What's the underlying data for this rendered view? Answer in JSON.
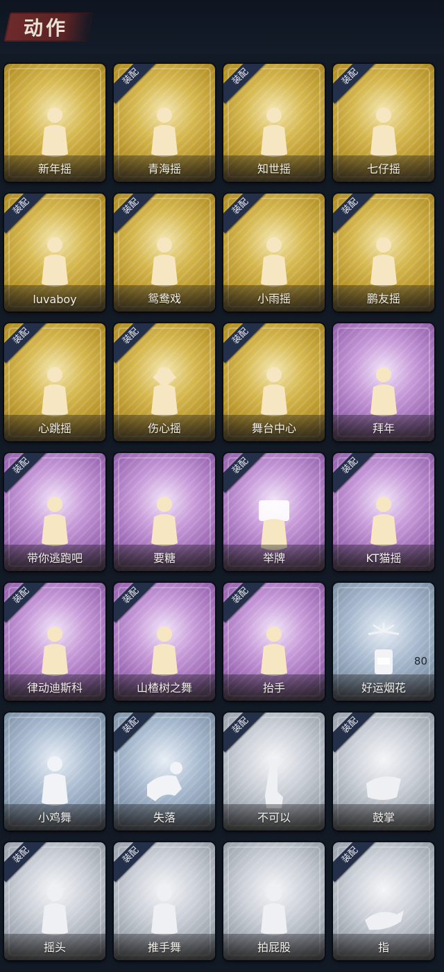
{
  "page": {
    "title": "动作",
    "colors": {
      "gold": "#d6b84f",
      "purple": "#b786cc",
      "blue": "#8ea2b7",
      "silver": "#aeb4bd"
    }
  },
  "badge_text": "装配",
  "cards": [
    {
      "label": "新年摇",
      "tier": "gold",
      "equipped": false,
      "icon": "dancer-icon"
    },
    {
      "label": "青海摇",
      "tier": "gold",
      "equipped": true,
      "icon": "dancer-icon"
    },
    {
      "label": "知世摇",
      "tier": "gold",
      "equipped": true,
      "icon": "dancer-icon"
    },
    {
      "label": "七仔摇",
      "tier": "gold",
      "equipped": true,
      "icon": "dancer-icon"
    },
    {
      "label": "luvaboy",
      "tier": "gold",
      "equipped": true,
      "icon": "dancer-icon"
    },
    {
      "label": "鸳鸯戏",
      "tier": "gold",
      "equipped": true,
      "icon": "dancer-icon"
    },
    {
      "label": "小雨摇",
      "tier": "gold",
      "equipped": true,
      "icon": "dancer-icon"
    },
    {
      "label": "鹏友摇",
      "tier": "gold",
      "equipped": true,
      "icon": "dancer-icon"
    },
    {
      "label": "心跳摇",
      "tier": "gold",
      "equipped": true,
      "icon": "dancer-icon"
    },
    {
      "label": "伤心摇",
      "tier": "gold",
      "equipped": true,
      "icon": "heart-hands-icon"
    },
    {
      "label": "舞台中心",
      "tier": "gold",
      "equipped": true,
      "icon": "dancer-icon"
    },
    {
      "label": "拜年",
      "tier": "purple",
      "equipped": false,
      "icon": "bow-icon"
    },
    {
      "label": "带你逃跑吧",
      "tier": "purple",
      "equipped": true,
      "icon": "dancer-icon"
    },
    {
      "label": "要糖",
      "tier": "purple",
      "equipped": false,
      "icon": "beg-icon"
    },
    {
      "label": "举牌",
      "tier": "purple",
      "equipped": true,
      "icon": "sign-icon"
    },
    {
      "label": "KT猫摇",
      "tier": "purple",
      "equipped": true,
      "icon": "dancer-icon"
    },
    {
      "label": "律动迪斯科",
      "tier": "purple",
      "equipped": true,
      "icon": "dancer-icon"
    },
    {
      "label": "山楂树之舞",
      "tier": "purple",
      "equipped": true,
      "icon": "dancer-icon"
    },
    {
      "label": "抬手",
      "tier": "purple",
      "equipped": true,
      "icon": "wave-icon"
    },
    {
      "label": "好运烟花",
      "tier": "blue",
      "equipped": false,
      "icon": "firework-icon",
      "count": "80"
    },
    {
      "label": "小鸡舞",
      "tier": "blue",
      "equipped": false,
      "icon": "chicken-dance-icon"
    },
    {
      "label": "失落",
      "tier": "blue",
      "equipped": true,
      "icon": "crawl-icon"
    },
    {
      "label": "不可以",
      "tier": "silver",
      "equipped": true,
      "icon": "finger-icon"
    },
    {
      "label": "鼓掌",
      "tier": "silver",
      "equipped": true,
      "icon": "clap-icon"
    },
    {
      "label": "摇头",
      "tier": "silver",
      "equipped": true,
      "icon": "shake-head-icon"
    },
    {
      "label": "推手舞",
      "tier": "silver",
      "equipped": true,
      "icon": "push-hands-icon"
    },
    {
      "label": "拍屁股",
      "tier": "silver",
      "equipped": false,
      "icon": "butt-slap-icon"
    },
    {
      "label": "指",
      "tier": "silver",
      "equipped": true,
      "icon": "point-icon"
    }
  ]
}
